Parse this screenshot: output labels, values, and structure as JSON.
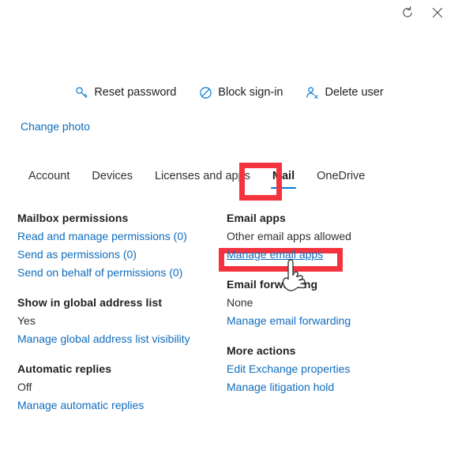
{
  "panel": {
    "header_icons": [
      {
        "name": "refresh-icon",
        "label": "Refresh"
      },
      {
        "name": "close-icon",
        "label": "Close"
      }
    ]
  },
  "command_bar": {
    "items": [
      {
        "icon": "key-icon",
        "label": "Reset password"
      },
      {
        "icon": "block-icon",
        "label": "Block sign-in"
      },
      {
        "icon": "delete-user-icon",
        "label": "Delete user"
      }
    ]
  },
  "profile": {
    "change_photo_label": "Change photo"
  },
  "tabs": {
    "items": [
      {
        "label": "Account",
        "selected": false
      },
      {
        "label": "Devices",
        "selected": false
      },
      {
        "label": "Licenses and apps",
        "selected": false
      },
      {
        "label": "Mail",
        "selected": true
      },
      {
        "label": "OneDrive",
        "selected": false
      }
    ]
  },
  "mail_tab": {
    "left_column": [
      {
        "title": "Mailbox permissions",
        "links": [
          "Read and manage permissions (0)",
          "Send as permissions (0)",
          "Send on behalf of permissions (0)"
        ]
      },
      {
        "title": "Show in global address list",
        "value": "Yes",
        "links": [
          "Manage global address list visibility"
        ]
      },
      {
        "title": "Automatic replies",
        "value": "Off",
        "links": [
          "Manage automatic replies"
        ]
      }
    ],
    "right_column": [
      {
        "title": "Email apps",
        "value": "Other email apps allowed",
        "links": [
          "Manage email apps"
        ],
        "highlighted_link": "Manage email apps"
      },
      {
        "title": "Email forwarding",
        "value": "None",
        "links": [
          "Manage email forwarding"
        ]
      },
      {
        "title": "More actions",
        "links": [
          "Edit Exchange properties",
          "Manage litigation hold"
        ]
      }
    ]
  },
  "annotations": [
    {
      "name": "mail-tab-highlight",
      "target": "Mail"
    },
    {
      "name": "manage-email-apps-highlight",
      "target": "Manage email apps"
    }
  ],
  "colors": {
    "accent": "#0078d4",
    "link": "#0f6cbd",
    "annotation": "#f5333f",
    "text": "#201f1e"
  }
}
